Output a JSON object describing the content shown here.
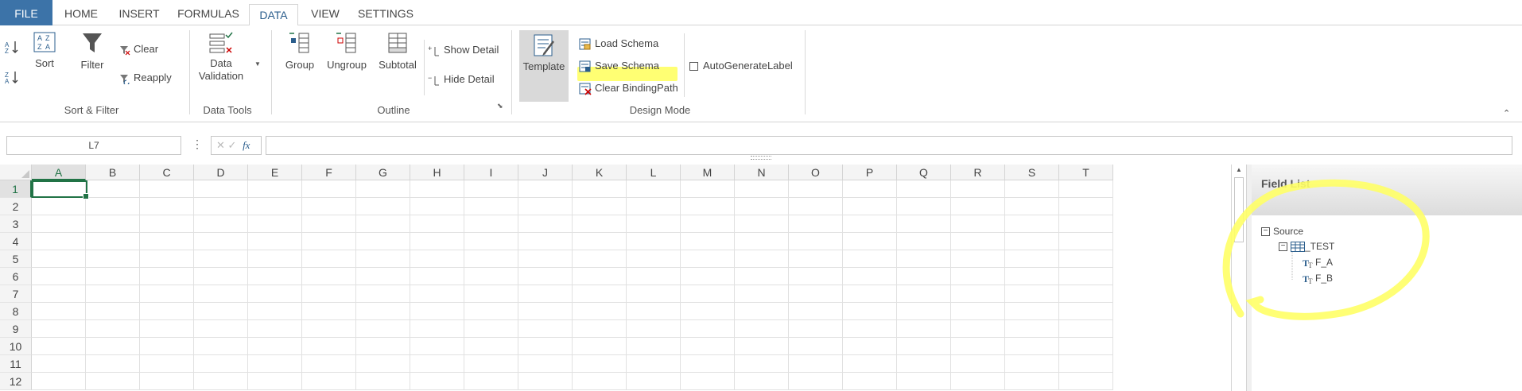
{
  "tabs": {
    "file": "FILE",
    "home": "HOME",
    "insert": "INSERT",
    "formulas": "FORMULAS",
    "data": "DATA",
    "view": "VIEW",
    "settings": "SETTINGS",
    "active": "DATA"
  },
  "ribbon": {
    "sort_filter": {
      "sort": "Sort",
      "filter": "Filter",
      "clear": "Clear",
      "reapply": "Reapply",
      "label": "Sort & Filter"
    },
    "data_tools": {
      "data_validation_1": "Data",
      "data_validation_2": "Validation",
      "label": "Data Tools"
    },
    "outline": {
      "group": "Group",
      "ungroup": "Ungroup",
      "subtotal": "Subtotal",
      "show_detail": "Show Detail",
      "hide_detail": "Hide Detail",
      "label": "Outline"
    },
    "design_mode": {
      "template": "Template",
      "load_schema": "Load Schema",
      "save_schema": "Save Schema",
      "clear_binding": "Clear BindingPath",
      "auto_generate": "AutoGenerateLabel",
      "label": "Design Mode"
    }
  },
  "formula_bar": {
    "name_box": "L7",
    "formula": ""
  },
  "grid": {
    "columns": [
      "A",
      "B",
      "C",
      "D",
      "E",
      "F",
      "G",
      "H",
      "I",
      "J",
      "K",
      "L",
      "M",
      "N",
      "O",
      "P",
      "Q",
      "R",
      "S",
      "T"
    ],
    "rows": [
      "1",
      "2",
      "3",
      "4",
      "5",
      "6",
      "7",
      "8",
      "9",
      "10",
      "11",
      "12"
    ],
    "selected_column": "A",
    "selected_row": "1"
  },
  "field_list": {
    "title": "Field List",
    "source": "Source",
    "table": "_TEST",
    "fields": [
      "F_A",
      "F_B"
    ]
  },
  "colors": {
    "file_tab": "#3c73a8",
    "selection": "#217346",
    "highlighter": "#ffff00"
  }
}
